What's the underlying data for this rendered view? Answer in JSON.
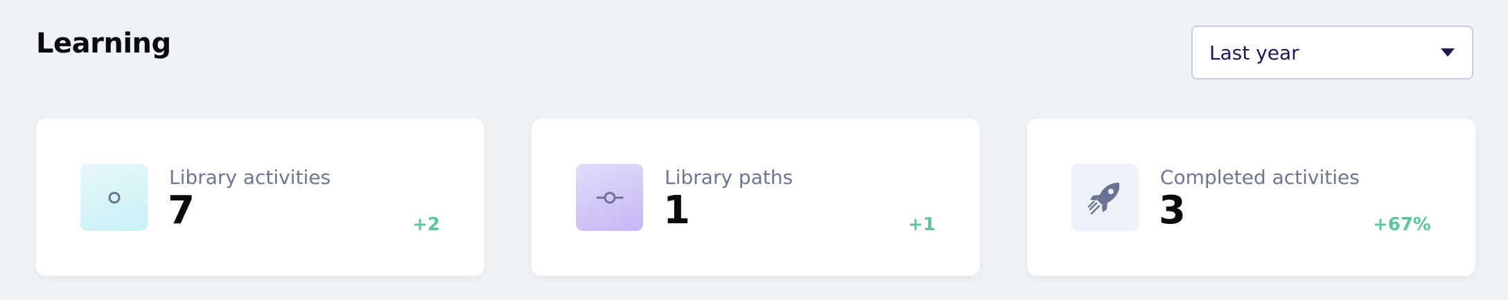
{
  "page": {
    "title": "Learning"
  },
  "period_select": {
    "value": "Last year",
    "caret_icon": "caret-down-icon"
  },
  "cards": [
    {
      "label": "Library activities",
      "count": "7",
      "delta": "+2",
      "icon": "circle-icon"
    },
    {
      "label": "Library paths",
      "count": "1",
      "delta": "+1",
      "icon": "commit-node-icon"
    },
    {
      "label": "Completed activities",
      "count": "3",
      "delta": "+67%",
      "icon": "rocket-icon"
    }
  ],
  "colors": {
    "background": "#f0f3f6",
    "card": "#ffffff",
    "label": "#6e7590",
    "delta_positive": "#5bc796",
    "select_text": "#1c1a55",
    "icon": "#6b7191"
  }
}
